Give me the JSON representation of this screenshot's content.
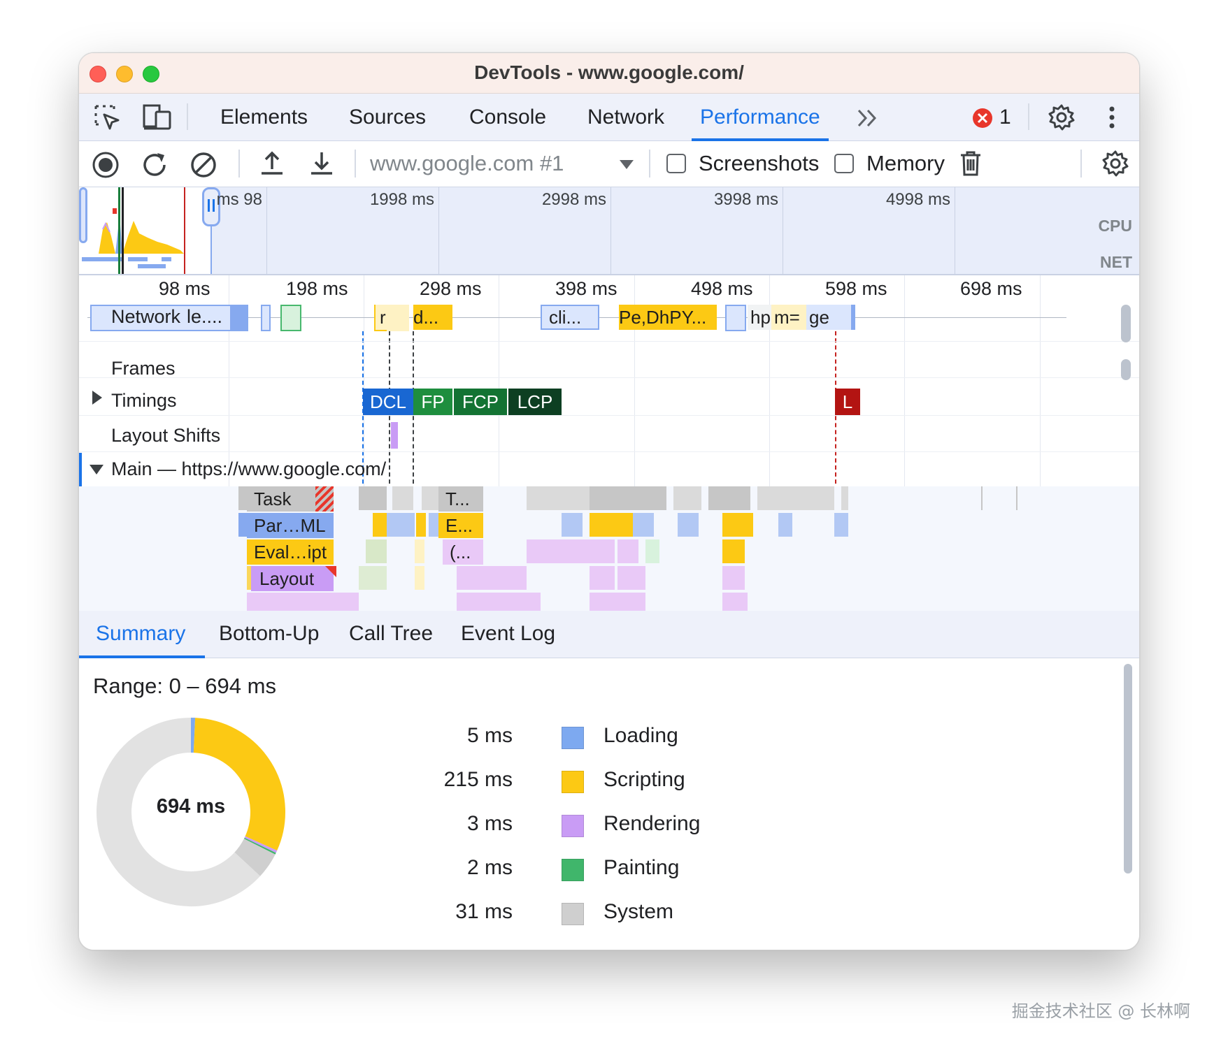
{
  "window": {
    "title": "DevTools - www.google.com/"
  },
  "tabs": {
    "items": [
      "Elements",
      "Sources",
      "Console",
      "Network",
      "Performance"
    ],
    "active": "Performance",
    "more_icon": "chevron-double-right-icon",
    "error_count": "1"
  },
  "toolbar": {
    "profile_select": "www.google.com #1",
    "screenshots_label": "Screenshots",
    "memory_label": "Memory"
  },
  "overview": {
    "ticks": [
      "98 ms",
      "1998 ms",
      "2998 ms",
      "3998 ms",
      "4998 ms"
    ],
    "cpu_label": "CPU",
    "net_label": "NET"
  },
  "flamechart": {
    "ruler": [
      "98 ms",
      "198 ms",
      "298 ms",
      "398 ms",
      "498 ms",
      "598 ms",
      "698 ms"
    ],
    "network_label": "Network",
    "network_items": [
      "le....",
      "r",
      "d...",
      "cli...",
      "Pe,DhPY...",
      "hp",
      "m=",
      "ge"
    ],
    "frames_label": "Frames",
    "timings_label": "Timings",
    "layout_shifts_label": "Layout Shifts",
    "main_label": "Main — https://www.google.com/",
    "markers": {
      "dcl": "DCL",
      "fp": "FP",
      "fcp": "FCP",
      "lcp": "LCP",
      "l": "L"
    },
    "blocks": {
      "task": "Task",
      "task2": "T...",
      "parse": "Par…ML",
      "eval2": "E...",
      "eval": "Eval…ipt",
      "paren": "(...",
      "layout": "Layout"
    },
    "colors": {
      "task": "#c6c6c6",
      "scripting": "#fcc914",
      "loading": "#86a9ef",
      "rendering": "#c99cf5",
      "painting": "#48b86d"
    }
  },
  "bottom_tabs": {
    "items": [
      "Summary",
      "Bottom-Up",
      "Call Tree",
      "Event Log"
    ],
    "active": "Summary"
  },
  "summary": {
    "range": "Range: 0 – 694 ms",
    "total": "694 ms",
    "rows": [
      {
        "value": "5 ms",
        "label": "Loading",
        "color": "#7da9f0",
        "ms": 5
      },
      {
        "value": "215 ms",
        "label": "Scripting",
        "color": "#fcc914",
        "ms": 215
      },
      {
        "value": "3 ms",
        "label": "Rendering",
        "color": "#c99cf5",
        "ms": 3
      },
      {
        "value": "2 ms",
        "label": "Painting",
        "color": "#40b66b",
        "ms": 2
      },
      {
        "value": "31 ms",
        "label": "System",
        "color": "#cfcfcf",
        "ms": 31
      }
    ],
    "idle_color": "#e2e2e2"
  },
  "watermark": "掘金技术社区 @ 长林啊"
}
